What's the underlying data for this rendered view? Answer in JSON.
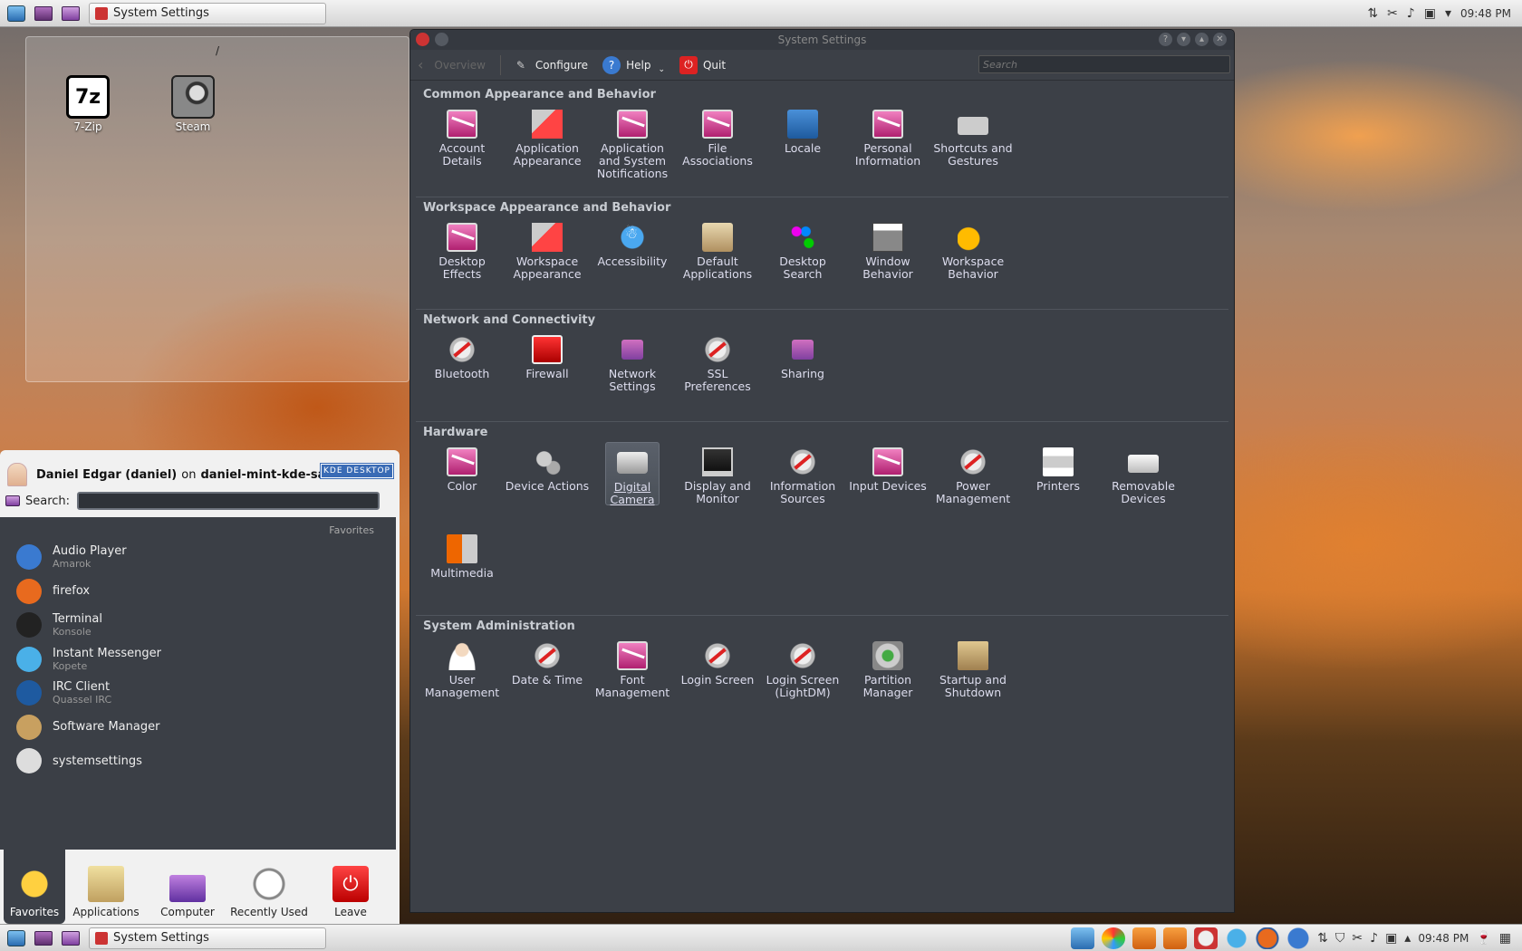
{
  "top_panel": {
    "task_title": "System Settings",
    "clock": "09:48 PM"
  },
  "desktop": {
    "folder_title": "/",
    "icons": [
      {
        "label": "7-Zip",
        "glyph": "7z"
      },
      {
        "label": "Steam"
      }
    ]
  },
  "launcher": {
    "user_name": "Daniel Edgar (daniel)",
    "on_word": "on",
    "host": "daniel-mint-kde-sat",
    "kde_badge": "KDE DESKTOP",
    "search_label": "Search:",
    "favorites_header": "Favorites",
    "favorites": [
      {
        "name": "Audio Player",
        "sub": "Amarok",
        "color": "#3a7ad0"
      },
      {
        "name": "firefox",
        "sub": "",
        "color": "#e86a1e"
      },
      {
        "name": "Terminal",
        "sub": "Konsole",
        "color": "#222222"
      },
      {
        "name": "Instant Messenger",
        "sub": "Kopete",
        "color": "#4ab0e8"
      },
      {
        "name": "IRC Client",
        "sub": "Quassel IRC",
        "color": "#1e5aa0"
      },
      {
        "name": "Software Manager",
        "sub": "",
        "color": "#c8a060"
      },
      {
        "name": "systemsettings",
        "sub": "",
        "color": "#dddddd"
      }
    ],
    "tabs": [
      "Favorites",
      "Applications",
      "Computer",
      "Recently Used",
      "Leave"
    ]
  },
  "window": {
    "title": "System Settings",
    "toolbar": {
      "overview": "Overview",
      "configure": "Configure",
      "help": "Help",
      "quit": "Quit",
      "search_placeholder": "Search"
    },
    "categories": [
      {
        "title": "Common Appearance and Behavior",
        "items": [
          {
            "label": "Account Details",
            "icon": "pref"
          },
          {
            "label": "Application Appearance",
            "icon": "paint"
          },
          {
            "label": "Application and System Notifications",
            "icon": "pref"
          },
          {
            "label": "File Associations",
            "icon": "pref"
          },
          {
            "label": "Locale",
            "icon": "locale"
          },
          {
            "label": "Personal Information",
            "icon": "pref"
          },
          {
            "label": "Shortcuts and Gestures",
            "icon": "kbd"
          }
        ]
      },
      {
        "title": "Workspace Appearance and Behavior",
        "items": [
          {
            "label": "Desktop Effects",
            "icon": "pref"
          },
          {
            "label": "Workspace Appearance",
            "icon": "paint"
          },
          {
            "label": "Accessibility",
            "icon": "blue"
          },
          {
            "label": "Default Applications",
            "icon": "folder"
          },
          {
            "label": "Desktop Search",
            "icon": "search"
          },
          {
            "label": "Window Behavior",
            "icon": "window"
          },
          {
            "label": "Workspace Behavior",
            "icon": "moon"
          }
        ]
      },
      {
        "title": "Network and Connectivity",
        "items": [
          {
            "label": "Bluetooth",
            "icon": "wrench"
          },
          {
            "label": "Firewall",
            "icon": "red"
          },
          {
            "label": "Network Settings",
            "icon": "net"
          },
          {
            "label": "SSL Preferences",
            "icon": "wrench"
          },
          {
            "label": "Sharing",
            "icon": "net"
          }
        ]
      },
      {
        "title": "Hardware",
        "items": [
          {
            "label": "Color",
            "icon": "pref"
          },
          {
            "label": "Device Actions",
            "icon": "gears"
          },
          {
            "label": "Digital Camera",
            "icon": "camera",
            "selected": true
          },
          {
            "label": "Display and Monitor",
            "icon": "display"
          },
          {
            "label": "Information Sources",
            "icon": "wrench"
          },
          {
            "label": "Input Devices",
            "icon": "pref"
          },
          {
            "label": "Power Management",
            "icon": "wrench"
          },
          {
            "label": "Printers",
            "icon": "printer"
          },
          {
            "label": "Removable Devices",
            "icon": "drive"
          },
          {
            "label": "Multimedia",
            "icon": "media"
          }
        ]
      },
      {
        "title": "System Administration",
        "items": [
          {
            "label": "User Management",
            "icon": "user"
          },
          {
            "label": "Date & Time",
            "icon": "wrench"
          },
          {
            "label": "Font Management",
            "icon": "pref"
          },
          {
            "label": "Login Screen",
            "icon": "wrench"
          },
          {
            "label": "Login Screen (LightDM)",
            "icon": "wrench"
          },
          {
            "label": "Partition Manager",
            "icon": "disk"
          },
          {
            "label": "Startup and Shutdown",
            "icon": "box"
          }
        ]
      }
    ]
  },
  "bottom_panel": {
    "task_title": "System Settings",
    "clock": "09:48 PM"
  }
}
